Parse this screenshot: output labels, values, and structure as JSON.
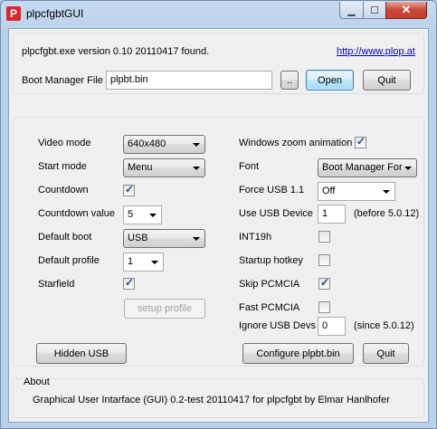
{
  "window": {
    "title": "plpcfgbtGUI",
    "app_icon_letter": "P"
  },
  "top": {
    "version_text": "plpcfgbt.exe version 0.10 20110417 found.",
    "link": "http://www.plop.at",
    "boot_manager_label": "Boot Manager File",
    "boot_manager_value": "plpbt.bin",
    "browse_label": "..",
    "open_label": "Open",
    "quit_label": "Quit"
  },
  "left": {
    "video_mode_label": "Video mode",
    "video_mode_value": "640x480",
    "start_mode_label": "Start mode",
    "start_mode_value": "Menu",
    "countdown_label": "Countdown",
    "countdown_checked": true,
    "countdown_value_label": "Countdown value",
    "countdown_value": "5",
    "default_boot_label": "Default boot",
    "default_boot_value": "USB",
    "default_profile_label": "Default profile",
    "default_profile_value": "1",
    "starfield_label": "Starfield",
    "starfield_checked": true,
    "setup_profile_label": "setup profile",
    "hidden_usb_label": "Hidden USB"
  },
  "right": {
    "zoom_label": "Windows zoom animation",
    "zoom_checked": true,
    "font_label": "Font",
    "font_value": "Boot Manager For",
    "force_usb_label": "Force USB 1.1",
    "force_usb_value": "Off",
    "use_usb_label": "Use USB Device",
    "use_usb_value": "1",
    "use_usb_note": "(before 5.0.12)",
    "int19h_label": "INT19h",
    "int19h_checked": false,
    "startup_hotkey_label": "Startup hotkey",
    "startup_hotkey_checked": false,
    "skip_pcmcia_label": "Skip PCMCIA",
    "skip_pcmcia_checked": true,
    "fast_pcmcia_label": "Fast PCMCIA",
    "fast_pcmcia_checked": false,
    "ignore_usb_label": "Ignore USB Devs",
    "ignore_usb_value": "0",
    "ignore_usb_note": "(since 5.0.12)",
    "configure_label": "Configure plpbt.bin",
    "quit_label": "Quit"
  },
  "about": {
    "heading": "About",
    "text": "Graphical User Intarface (GUI) 0.2-test 20110417 for plpcfgbt by Elmar Hanlhofer"
  }
}
